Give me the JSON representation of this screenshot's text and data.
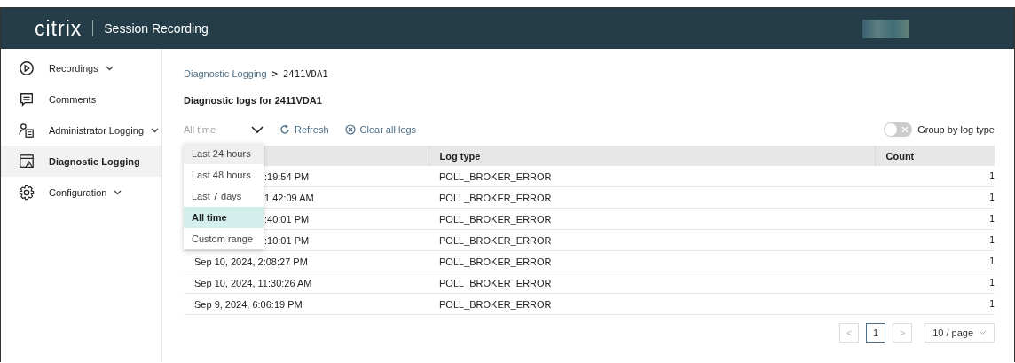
{
  "header": {
    "logo": "citrix",
    "title": "Session Recording"
  },
  "sidebar": {
    "items": [
      {
        "label": "Recordings",
        "expandable": true,
        "selected": false
      },
      {
        "label": "Comments",
        "expandable": false,
        "selected": false
      },
      {
        "label": "Administrator Logging",
        "expandable": true,
        "selected": false
      },
      {
        "label": "Diagnostic Logging",
        "expandable": false,
        "selected": true
      },
      {
        "label": "Configuration",
        "expandable": true,
        "selected": false
      }
    ]
  },
  "breadcrumb": {
    "link": "Diagnostic Logging",
    "separator": ">",
    "current": "2411VDA1"
  },
  "heading": "Diagnostic logs for 2411VDA1",
  "toolbar": {
    "time_filter": {
      "value": "All time",
      "expanded": true
    },
    "refresh": "Refresh",
    "clear": "Clear all logs",
    "group_toggle": {
      "label": "Group by log type",
      "on": false
    }
  },
  "dropdown_options": [
    {
      "label": "Last 24 hours",
      "selected": false,
      "hovered": true
    },
    {
      "label": "Last 48 hours",
      "selected": false,
      "hovered": false
    },
    {
      "label": "Last 7 days",
      "selected": false,
      "hovered": false
    },
    {
      "label": "All time",
      "selected": true,
      "hovered": false
    },
    {
      "label": "Custom range",
      "selected": false,
      "hovered": false
    }
  ],
  "table": {
    "columns": [
      "Log type",
      "Count"
    ],
    "rows": [
      {
        "time": ":19:54 PM",
        "log_type": "POLL_BROKER_ERROR",
        "count": "1"
      },
      {
        "time": "1:42:09 AM",
        "log_type": "POLL_BROKER_ERROR",
        "count": "1"
      },
      {
        "time": ":40:01 PM",
        "log_type": "POLL_BROKER_ERROR",
        "count": "1"
      },
      {
        "time": ":10:01 PM",
        "log_type": "POLL_BROKER_ERROR",
        "count": "1"
      },
      {
        "time": "Sep 10, 2024, 2:08:27 PM",
        "log_type": "POLL_BROKER_ERROR",
        "count": "1"
      },
      {
        "time": "Sep 10, 2024, 11:30:26 AM",
        "log_type": "POLL_BROKER_ERROR",
        "count": "1"
      },
      {
        "time": "Sep 9, 2024, 6:06:19 PM",
        "log_type": "POLL_BROKER_ERROR",
        "count": "1"
      }
    ]
  },
  "pagination": {
    "previous": "<",
    "next": ">",
    "pages": [
      {
        "label": "1",
        "selected": true
      }
    ],
    "page_size": "10 / page"
  }
}
